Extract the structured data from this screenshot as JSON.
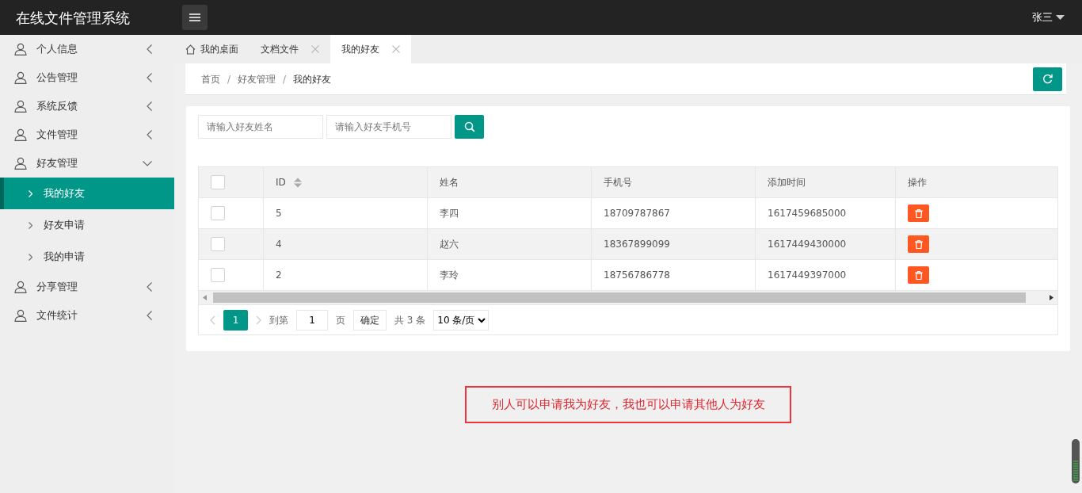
{
  "app_title": "在线文件管理系统",
  "user_menu": {
    "name": "张三"
  },
  "sidebar": {
    "items": [
      {
        "label": "个人信息",
        "expanded": false
      },
      {
        "label": "公告管理",
        "expanded": false
      },
      {
        "label": "系统反馈",
        "expanded": false
      },
      {
        "label": "文件管理",
        "expanded": false
      },
      {
        "label": "好友管理",
        "expanded": true,
        "children": [
          {
            "label": "我的好友",
            "selected": true
          },
          {
            "label": "好友申请",
            "selected": false
          },
          {
            "label": "我的申请",
            "selected": false
          }
        ]
      },
      {
        "label": "分享管理",
        "expanded": false
      },
      {
        "label": "文件统计",
        "expanded": false
      }
    ]
  },
  "tabs": [
    {
      "label": "我的桌面",
      "kind": "home",
      "selected": false
    },
    {
      "label": "文档文件",
      "kind": "closable",
      "selected": false
    },
    {
      "label": "我的好友",
      "kind": "closable",
      "selected": true
    }
  ],
  "breadcrumb": {
    "separator": "/",
    "items": [
      "首页",
      "好友管理",
      "我的好友"
    ]
  },
  "search": {
    "name_placeholder": "请输入好友姓名",
    "phone_placeholder": "请输入好友手机号"
  },
  "table": {
    "columns": [
      "ID",
      "姓名",
      "手机号",
      "添加时间",
      "操作"
    ],
    "header_checked": false,
    "rows": [
      {
        "id": "5",
        "name": "李四",
        "phone": "18709787867",
        "added": "1617459685000",
        "checked": false,
        "highlighted": false
      },
      {
        "id": "4",
        "name": "赵六",
        "phone": "18367899099",
        "added": "1617449430000",
        "checked": false,
        "highlighted": true
      },
      {
        "id": "2",
        "name": "李玲",
        "phone": "18756786778",
        "added": "1617449397000",
        "checked": false,
        "highlighted": false
      }
    ]
  },
  "pagination": {
    "pages": [
      {
        "label": "1",
        "selected": true
      }
    ],
    "goto_label": "到第",
    "goto_value": "1",
    "page_unit": "页",
    "confirm": "确定",
    "total": "共 3 条",
    "page_size": "10 条/页"
  },
  "note": "别人可以申请我为好友，我也可以申请其他人为好友"
}
